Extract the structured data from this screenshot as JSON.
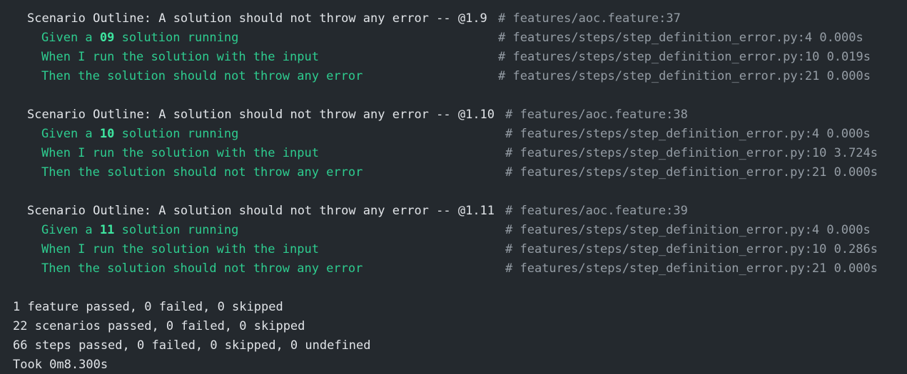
{
  "scenarios": [
    {
      "title": "Scenario Outline: A solution should not throw any error -- @1.9",
      "location": "# features/aoc.feature:37",
      "steps": [
        {
          "prefix": "Given a ",
          "day": "09",
          "suffix": " solution running",
          "location": "# features/steps/step_definition_error.py:4 0.000s"
        },
        {
          "prefix": "When I run the solution with the input",
          "day": "",
          "suffix": "",
          "location": "# features/steps/step_definition_error.py:10 0.019s"
        },
        {
          "prefix": "Then the solution should not throw any error",
          "day": "",
          "suffix": "",
          "location": "# features/steps/step_definition_error.py:21 0.000s"
        }
      ]
    },
    {
      "title": "Scenario Outline: A solution should not throw any error -- @1.10",
      "location": "# features/aoc.feature:38",
      "steps": [
        {
          "prefix": "Given a ",
          "day": "10",
          "suffix": " solution running",
          "location": "# features/steps/step_definition_error.py:4 0.000s"
        },
        {
          "prefix": "When I run the solution with the input",
          "day": "",
          "suffix": "",
          "location": "# features/steps/step_definition_error.py:10 3.724s"
        },
        {
          "prefix": "Then the solution should not throw any error",
          "day": "",
          "suffix": "",
          "location": "# features/steps/step_definition_error.py:21 0.000s"
        }
      ]
    },
    {
      "title": "Scenario Outline: A solution should not throw any error -- @1.11",
      "location": "# features/aoc.feature:39",
      "steps": [
        {
          "prefix": "Given a ",
          "day": "11",
          "suffix": " solution running",
          "location": "# features/steps/step_definition_error.py:4 0.000s"
        },
        {
          "prefix": "When I run the solution with the input",
          "day": "",
          "suffix": "",
          "location": "# features/steps/step_definition_error.py:10 0.286s"
        },
        {
          "prefix": "Then the solution should not throw any error",
          "day": "",
          "suffix": "",
          "location": "# features/steps/step_definition_error.py:21 0.000s"
        }
      ]
    }
  ],
  "summary": {
    "features": "1 feature passed, 0 failed, 0 skipped",
    "scenarios": "22 scenarios passed, 0 failed, 0 skipped",
    "steps": "66 steps passed, 0 failed, 0 skipped, 0 undefined",
    "took": "Took 0m8.300s"
  }
}
